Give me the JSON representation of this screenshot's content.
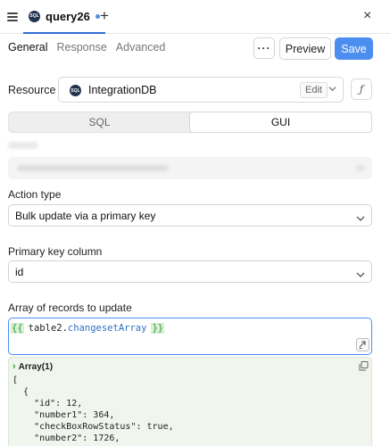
{
  "tabbar": {
    "query_name": "query26",
    "badge_text": "SQL",
    "new_tab_glyph": "+",
    "close_glyph": "×"
  },
  "subtabs": [
    {
      "label": "General",
      "active": true
    },
    {
      "label": "Response",
      "active": false
    },
    {
      "label": "Advanced",
      "active": false
    }
  ],
  "toolbar": {
    "more_label": "···",
    "preview_label": "Preview",
    "save_label": "Save"
  },
  "resource": {
    "label": "Resource",
    "name": "IntegrationDB",
    "edit_label": "Edit",
    "fx_label": "ƒ"
  },
  "mode_toggle": {
    "options": [
      "SQL",
      "GUI"
    ],
    "selected": "GUI"
  },
  "action_type": {
    "label": "Action type",
    "value": "Bulk update via a primary key"
  },
  "primary_key": {
    "label": "Primary key column",
    "value": "id"
  },
  "records": {
    "label": "Array of records to update",
    "open_brace": "{{",
    "close_brace": "}}",
    "object": "table2",
    "property": "changesetArray"
  },
  "preview": {
    "title": "Array(1)",
    "lines": [
      "[",
      "  {",
      "    \"id\": 12,",
      "    \"number1\": 364,",
      "    \"checkBoxRowStatus\": true,",
      "    \"number2\": 1726,"
    ]
  },
  "colors": {
    "accent": "#4c8ef0",
    "tab_underline": "#2f6fd6",
    "brace_bg": "#d7f0d4",
    "brace_fg": "#2d9a3a",
    "preview_bg": "#f0f6ee"
  }
}
